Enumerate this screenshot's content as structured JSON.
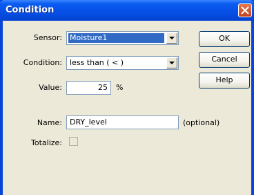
{
  "window": {
    "title": "Condition"
  },
  "form": {
    "sensor_label": "Sensor:",
    "sensor_value": "Moisture1",
    "condition_label": "Condition:",
    "condition_value": "less than ( < )",
    "value_label": "Value:",
    "value_value": "25",
    "value_unit": "%",
    "name_label": "Name:",
    "name_value": "DRY_level",
    "name_hint": "(optional)",
    "totalize_label": "Totalize:",
    "totalize_checked": false
  },
  "buttons": {
    "ok": "OK",
    "cancel": "Cancel",
    "help": "Help"
  },
  "colors": {
    "title_bar": "#0650e8",
    "face": "#ece9d8",
    "selection": "#316ac5",
    "close": "#d4552b"
  }
}
